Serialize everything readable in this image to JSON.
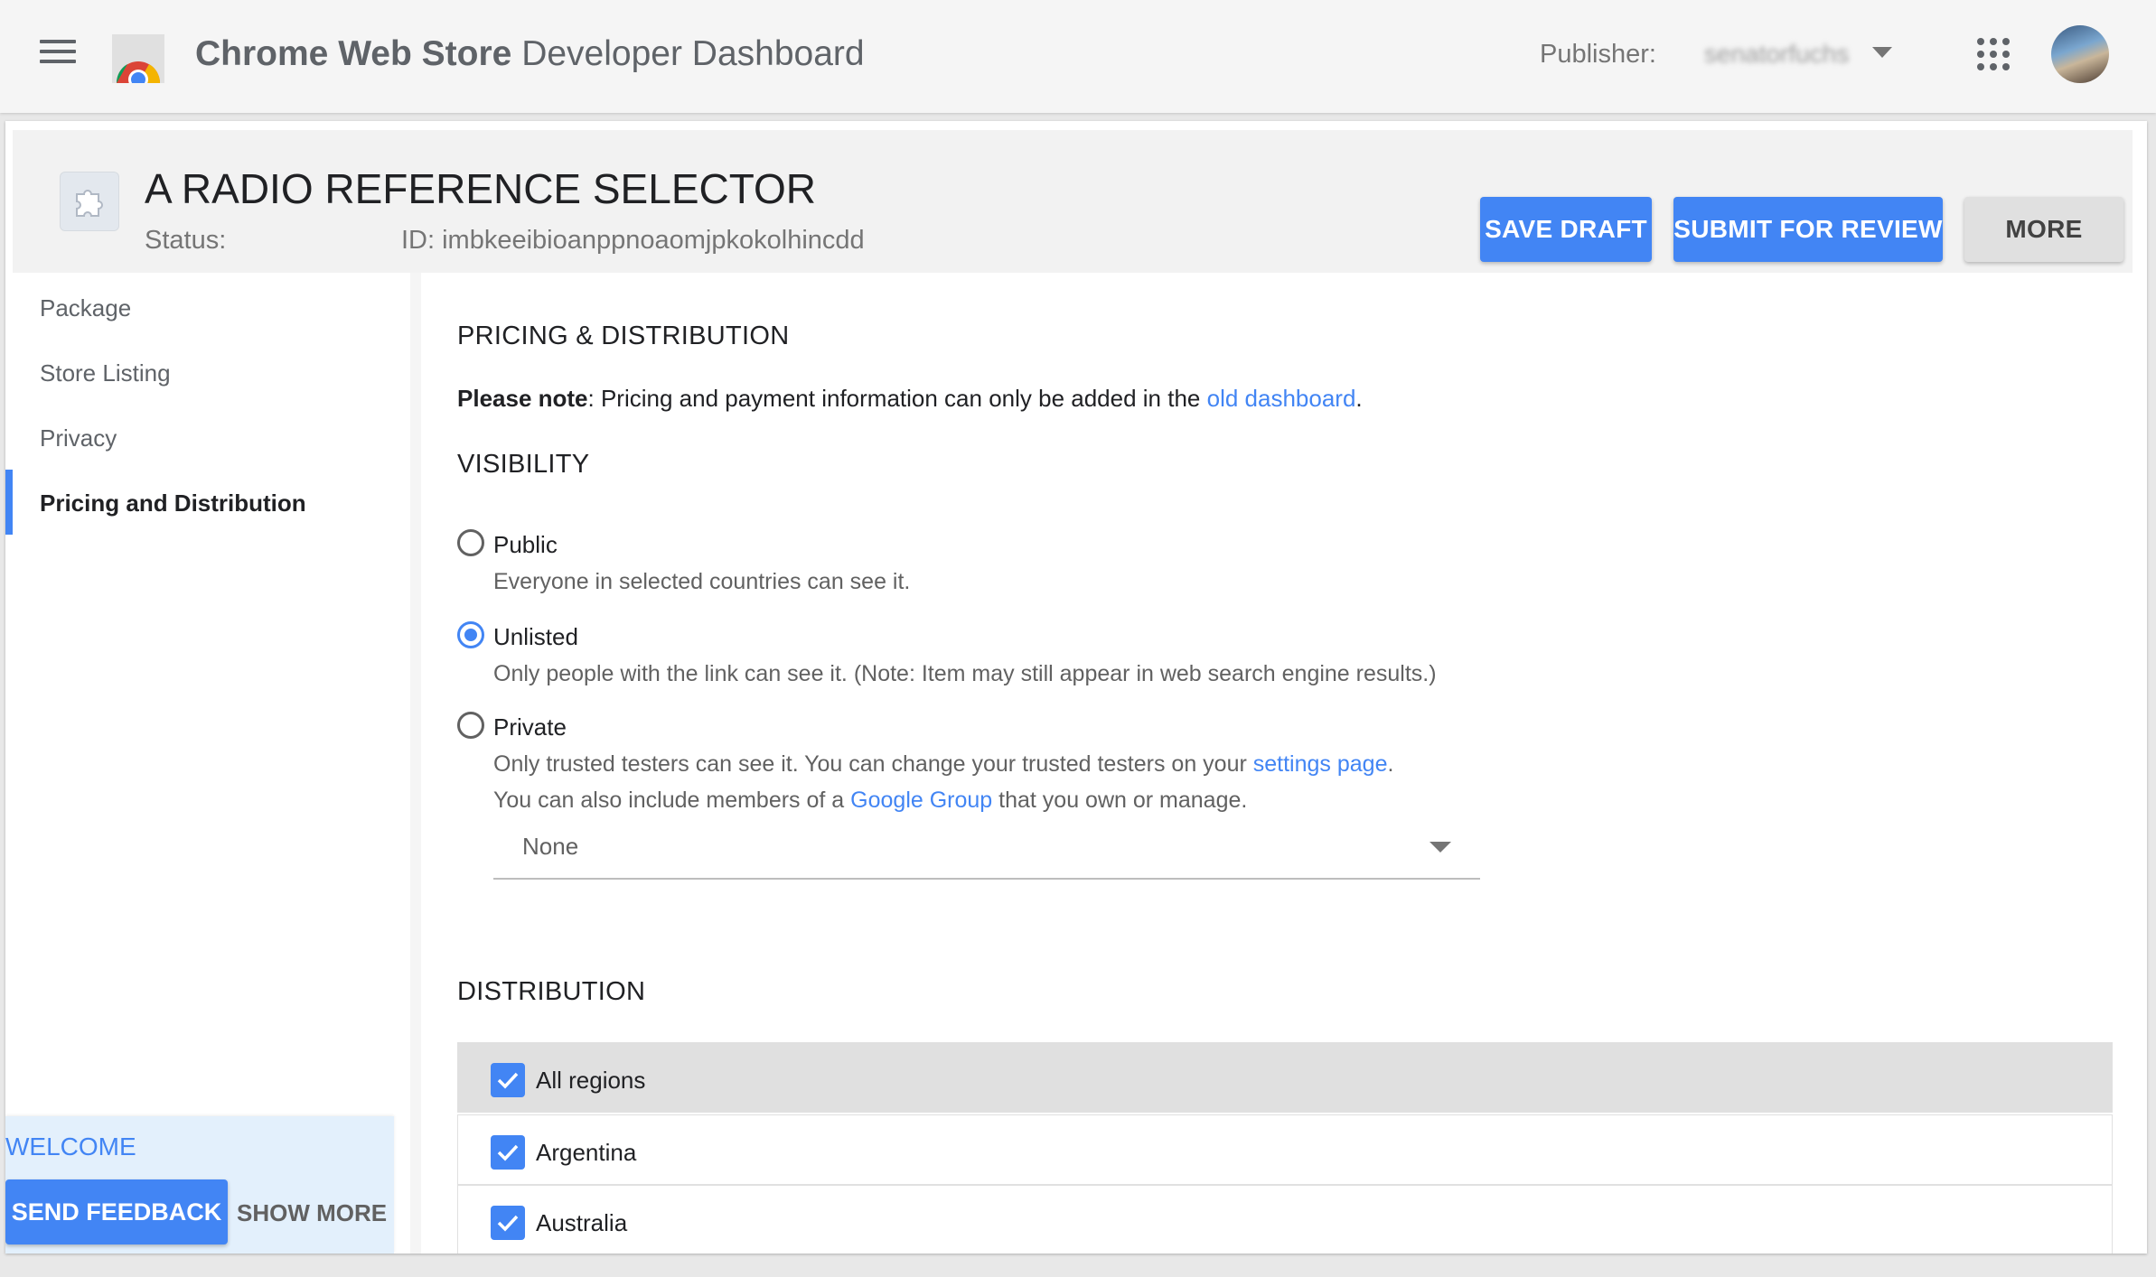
{
  "topbar": {
    "title_bold": "Chrome Web Store",
    "title_rest": "Developer Dashboard",
    "publisher_label": "Publisher:",
    "publisher_value": "senatorfuchs"
  },
  "item": {
    "title": "A RADIO REFERENCE SELECTOR",
    "status_label": "Status:",
    "id_text": "ID: imbkeeibioanppnoaomjpkokolhincdd"
  },
  "actions": {
    "save_draft": "SAVE DRAFT",
    "submit": "SUBMIT FOR REVIEW",
    "more": "MORE"
  },
  "sidebar": {
    "items": [
      {
        "label": "Package"
      },
      {
        "label": "Store Listing"
      },
      {
        "label": "Privacy"
      },
      {
        "label": "Pricing and Distribution"
      }
    ],
    "welcome": "WELCOME",
    "send_feedback": "SEND FEEDBACK",
    "show_more": "SHOW MORE"
  },
  "pricing": {
    "title": "PRICING & DISTRIBUTION",
    "note_bold": "Please note",
    "note_text": ": Pricing and payment information can only be added in the ",
    "note_link": "old dashboard",
    "note_end": "."
  },
  "visibility": {
    "title": "VISIBILITY",
    "selected": "Unlisted",
    "options": [
      {
        "label": "Public",
        "desc": "Everyone in selected countries can see it."
      },
      {
        "label": "Unlisted",
        "desc": "Only people with the link can see it. (Note: Item may still appear in web search engine results.)"
      },
      {
        "label": "Private",
        "desc1": "Only trusted testers can see it. You can change your trusted testers on your ",
        "desc1_link": "settings page",
        "desc1_end": ".",
        "desc2": "You can also include members of a ",
        "desc2_link": "Google Group",
        "desc2_end": " that you own or manage."
      }
    ],
    "group_select_value": "None"
  },
  "distribution": {
    "title": "DISTRIBUTION",
    "rows": [
      {
        "label": "All regions",
        "checked": true
      },
      {
        "label": "Argentina",
        "checked": true
      },
      {
        "label": "Australia",
        "checked": true
      }
    ]
  },
  "colors": {
    "accent": "#4285f4",
    "header_bg": "#f2f2f2"
  },
  "icons": [
    "menu-icon",
    "chrome-web-store-logo",
    "apps-grid-icon",
    "puzzle-icon",
    "dropdown-caret-icon",
    "checkmark-icon"
  ]
}
